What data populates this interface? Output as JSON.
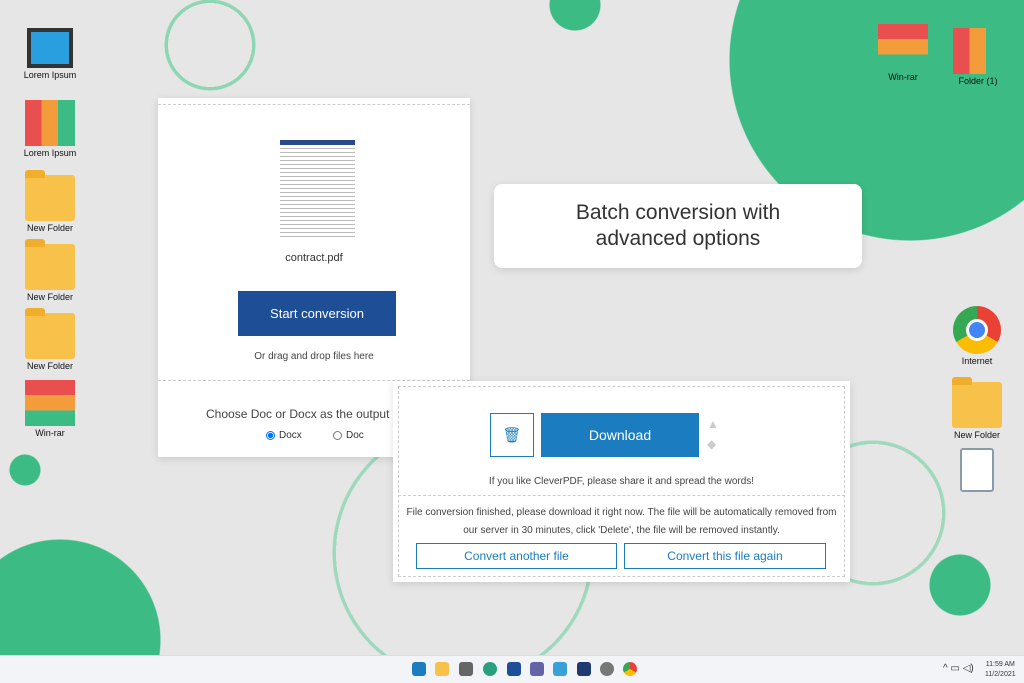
{
  "desktop_left": [
    {
      "label": "Lorem Ipsum",
      "icon": "computer-icon"
    },
    {
      "label": "Lorem Ipsum",
      "icon": "binders-icon"
    },
    {
      "label": "New Folder",
      "icon": "folder-icon"
    },
    {
      "label": "New Folder",
      "icon": "folder-icon"
    },
    {
      "label": "New Folder",
      "icon": "folder-icon"
    },
    {
      "label": "Win-rar",
      "icon": "winrar-icon"
    }
  ],
  "desktop_right": [
    {
      "label": "Win-rar",
      "icon": "winrar-icon"
    },
    {
      "label": "Folder (1)",
      "icon": "binders-icon"
    },
    {
      "label": "Internet",
      "icon": "chrome-icon"
    },
    {
      "label": "New Folder",
      "icon": "folder-icon"
    }
  ],
  "callout": "Batch conversion with advanced options",
  "converter": {
    "file_name": "contract.pdf",
    "start_button": "Start conversion",
    "drag_hint": "Or drag and drop files here",
    "output_label": "Choose Doc or Docx as the output",
    "options": [
      "Docx",
      "Doc"
    ],
    "selected": "Docx"
  },
  "result": {
    "download": "Download",
    "share_text": "If you like CleverPDF, please share it and spread the words!",
    "notice": "File conversion finished, please download it right now. The file will be automatically removed from our server in 30 minutes, click 'Delete', the file will be removed instantly.",
    "convert_another": "Convert another file",
    "convert_again": "Convert this file again"
  },
  "taskbar": {
    "time": "11:59 AM",
    "date": "11/2/2021"
  },
  "colors": {
    "green": "#3dbb84",
    "accent": "#1b7dc0",
    "start_btn": "#1e4f96"
  }
}
